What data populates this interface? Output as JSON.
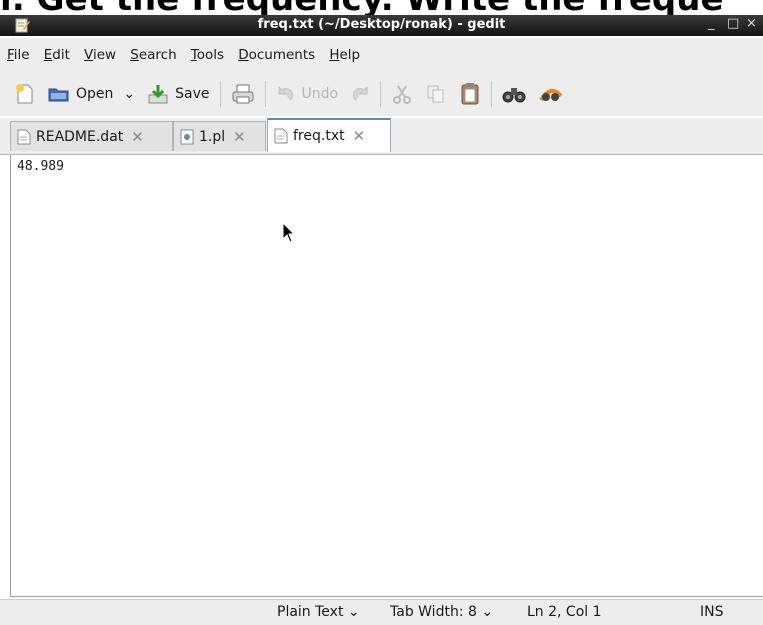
{
  "overlay": {
    "text": "r. Get the frequency. Write the freque"
  },
  "window": {
    "title": "freq.txt (~/Desktop/ronak) - gedit",
    "minimize": "_",
    "maximize": "□",
    "close": "×"
  },
  "menu": {
    "items": [
      {
        "label": "File",
        "u": "F",
        "rest": "ile"
      },
      {
        "label": "Edit",
        "u": "E",
        "rest": "dit"
      },
      {
        "label": "View",
        "u": "V",
        "rest": "iew"
      },
      {
        "label": "Search",
        "u": "S",
        "rest": "earch"
      },
      {
        "label": "Tools",
        "u": "T",
        "rest": "ools"
      },
      {
        "label": "Documents",
        "u": "D",
        "rest": "ocuments"
      },
      {
        "label": "Help",
        "u": "H",
        "rest": "elp"
      }
    ]
  },
  "toolbar": {
    "open_label": "Open",
    "save_label": "Save",
    "undo_label": "Undo",
    "dropdown_glyph": "⌄"
  },
  "tabs": [
    {
      "label": "README.dat",
      "close": "✕"
    },
    {
      "label": "1.pl",
      "close": "✕"
    },
    {
      "label": "freq.txt",
      "close": "✕"
    }
  ],
  "editor": {
    "content": "48.989"
  },
  "statusbar": {
    "language": "Plain Text ⌄",
    "tab_width": "Tab Width:  8 ⌄",
    "position": "Ln 2, Col 1",
    "mode": "INS"
  },
  "colors": {
    "titlebar": "#1e1e1e",
    "chrome": "#ededed",
    "accent": "#6b88b5"
  }
}
